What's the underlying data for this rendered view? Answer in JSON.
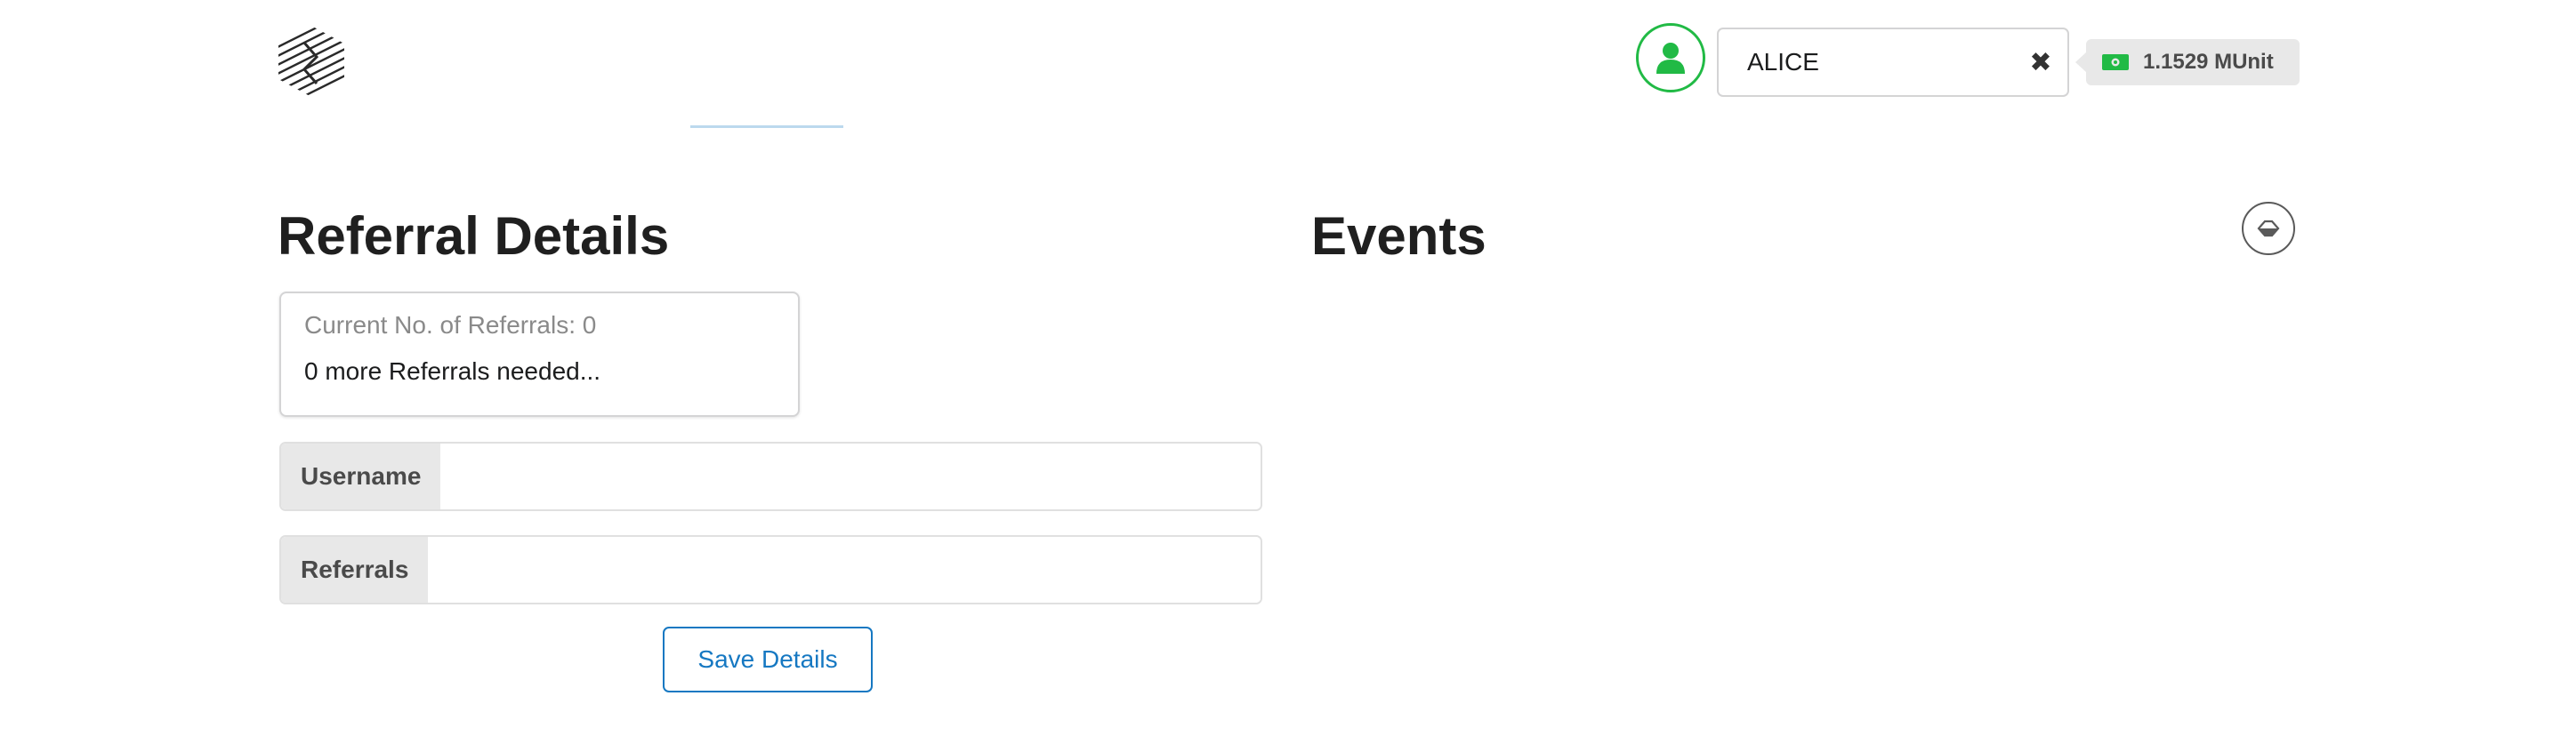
{
  "header": {
    "user_name": "ALICE",
    "clear_symbol": "✖",
    "balance": "1.1529 MUnit",
    "colors": {
      "user_ring": "#21ba45",
      "money_icon": "#21ba45"
    }
  },
  "referral": {
    "title": "Referral Details",
    "current_text": "Current No. of Referrals: 0",
    "needed_text": "0 more Referrals needed...",
    "username_label": "Username",
    "username_value": "",
    "referrals_label": "Referrals",
    "referrals_value": "",
    "save_label": "Save Details",
    "accent_color": "#1678c2"
  },
  "events": {
    "title": "Events",
    "clear_icon": "eraser-icon"
  }
}
